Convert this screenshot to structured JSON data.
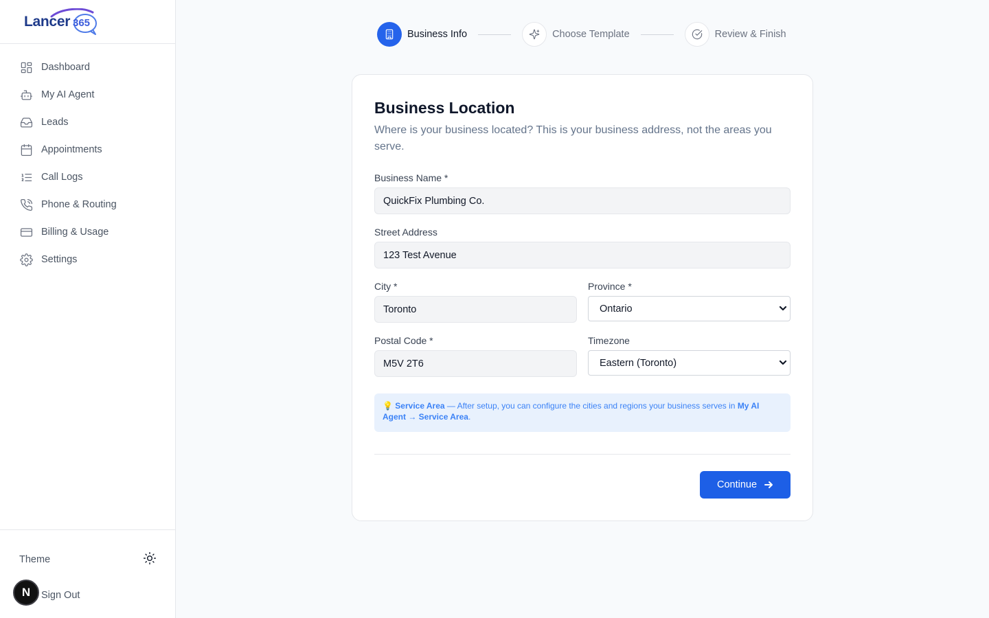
{
  "brand": {
    "name": "Lancer",
    "number": "365"
  },
  "sidebar": {
    "items": [
      {
        "label": "Dashboard",
        "icon": "dashboard-icon"
      },
      {
        "label": "My AI Agent",
        "icon": "bot-icon"
      },
      {
        "label": "Leads",
        "icon": "inbox-icon"
      },
      {
        "label": "Appointments",
        "icon": "calendar-icon"
      },
      {
        "label": "Call Logs",
        "icon": "list-ordered-icon"
      },
      {
        "label": "Phone & Routing",
        "icon": "phone-icon"
      },
      {
        "label": "Billing & Usage",
        "icon": "credit-card-icon"
      },
      {
        "label": "Settings",
        "icon": "gear-icon"
      }
    ],
    "theme_label": "Theme",
    "theme_icon": "sun-icon",
    "signout_label": "Sign Out",
    "avatar_initial": "N"
  },
  "stepper": {
    "steps": [
      {
        "label": "Business Info",
        "icon": "building-icon",
        "active": true
      },
      {
        "label": "Choose Template",
        "icon": "sparkles-icon",
        "active": false
      },
      {
        "label": "Review & Finish",
        "icon": "check-circle-icon",
        "active": false
      }
    ]
  },
  "form": {
    "title": "Business Location",
    "subtitle": "Where is your business located? This is your business address, not the areas you serve.",
    "business_name": {
      "label": "Business Name *",
      "value": "QuickFix Plumbing Co."
    },
    "street": {
      "label": "Street Address",
      "value": "123 Test Avenue"
    },
    "city": {
      "label": "City *",
      "value": "Toronto"
    },
    "province": {
      "label": "Province *",
      "value": "Ontario"
    },
    "postal": {
      "label": "Postal Code *",
      "value": "M5V 2T6"
    },
    "timezone": {
      "label": "Timezone",
      "value": "Eastern (Toronto)"
    },
    "info": {
      "emoji": "💡",
      "bold_lead": "Service Area",
      "text": " — After setup, you can configure the cities and regions your business serves in ",
      "bold_path": "My AI Agent → Service Area",
      "end": "."
    },
    "continue_label": "Continue"
  },
  "colors": {
    "accent": "#2563eb",
    "info_bg": "#e8f1fd",
    "info_text": "#3b82f6"
  }
}
